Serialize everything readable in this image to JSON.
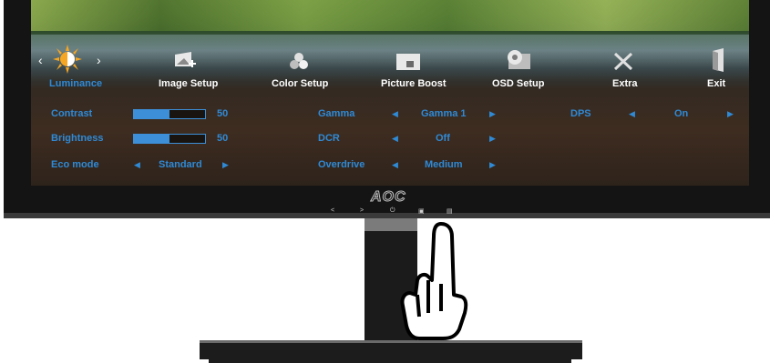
{
  "brand": {
    "logo_text": "AOC"
  },
  "osd": {
    "tabs": [
      {
        "label": "Luminance",
        "icon": "brightness-icon",
        "active": true
      },
      {
        "label": "Image Setup",
        "icon": "image-setup-icon",
        "active": false
      },
      {
        "label": "Color Setup",
        "icon": "color-setup-icon",
        "active": false
      },
      {
        "label": "Picture Boost",
        "icon": "picture-boost-icon",
        "active": false
      },
      {
        "label": "OSD Setup",
        "icon": "osd-setup-icon",
        "active": false
      },
      {
        "label": "Extra",
        "icon": "extra-icon",
        "active": false
      },
      {
        "label": "Exit",
        "icon": "exit-icon",
        "active": false
      }
    ],
    "items": {
      "contrast": {
        "label": "Contrast",
        "value": "50",
        "level": 0.5
      },
      "brightness": {
        "label": "Brightness",
        "value": "50",
        "level": 0.5
      },
      "eco_mode": {
        "label": "Eco mode",
        "value": "Standard"
      },
      "gamma": {
        "label": "Gamma",
        "value": "Gamma 1"
      },
      "dcr": {
        "label": "DCR",
        "value": "Off"
      },
      "overdrive": {
        "label": "Overdrive",
        "value": "Medium"
      },
      "dps": {
        "label": "DPS",
        "value": "On"
      }
    }
  },
  "colors": {
    "accent": "#2f8ad6",
    "bezel": "#141414",
    "label_active": "#2f8ad6",
    "label_inactive": "#ffffff"
  },
  "hardware_buttons": [
    "left-arrow-button",
    "right-arrow-button",
    "power-button",
    "source-button",
    "menu-button"
  ]
}
